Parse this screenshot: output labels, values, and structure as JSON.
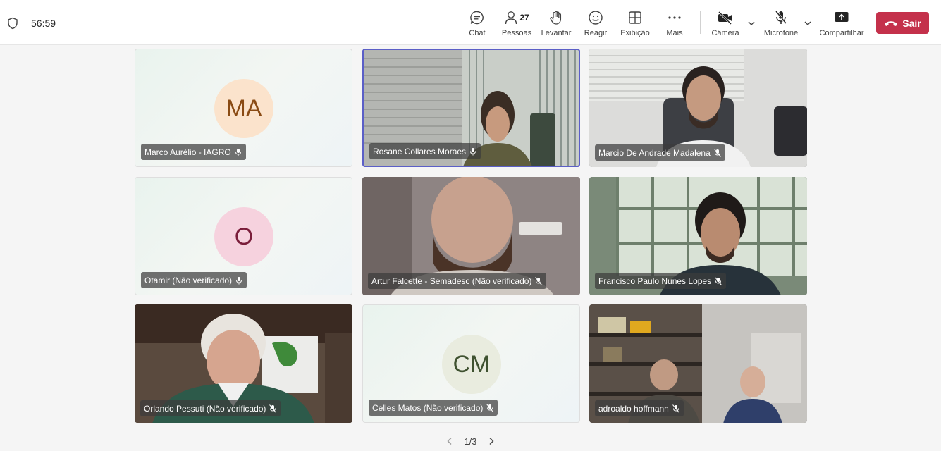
{
  "meeting": {
    "timer": "56:59"
  },
  "toolbar": {
    "chat": "Chat",
    "people": "Pessoas",
    "people_count": "27",
    "raise": "Levantar",
    "react": "Reagir",
    "view": "Exibição",
    "more": "Mais",
    "camera": "Câmera",
    "mic": "Microfone",
    "share": "Compartilhar",
    "leave": "Sair"
  },
  "participants": [
    {
      "name": "Marco Aurélio - IAGRO",
      "initials": "MA",
      "avatar_bg": "#fbe3cc",
      "avatar_fg": "#8a4b14"
    },
    {
      "name": "Rosane Collares Moraes"
    },
    {
      "name": "Marcio De Andrade Madalena"
    },
    {
      "name": "Otamir (Não verificado)",
      "initials": "O",
      "avatar_bg": "#f6d2de",
      "avatar_fg": "#7a1d3a"
    },
    {
      "name": "Artur Falcette - Semadesc (Não verificado)"
    },
    {
      "name": "Francisco Paulo Nunes Lopes"
    },
    {
      "name": "Orlando Pessuti (Não verificado)"
    },
    {
      "name": "Celles Matos (Não verificado)",
      "initials": "CM",
      "avatar_bg": "#e9ecdf",
      "avatar_fg": "#3f5230"
    },
    {
      "name": "adroaldo hoffmann"
    }
  ],
  "pager": {
    "text": "1/3"
  },
  "colors": {
    "leave": "#c4314b",
    "active_border": "#5b5fc7"
  }
}
